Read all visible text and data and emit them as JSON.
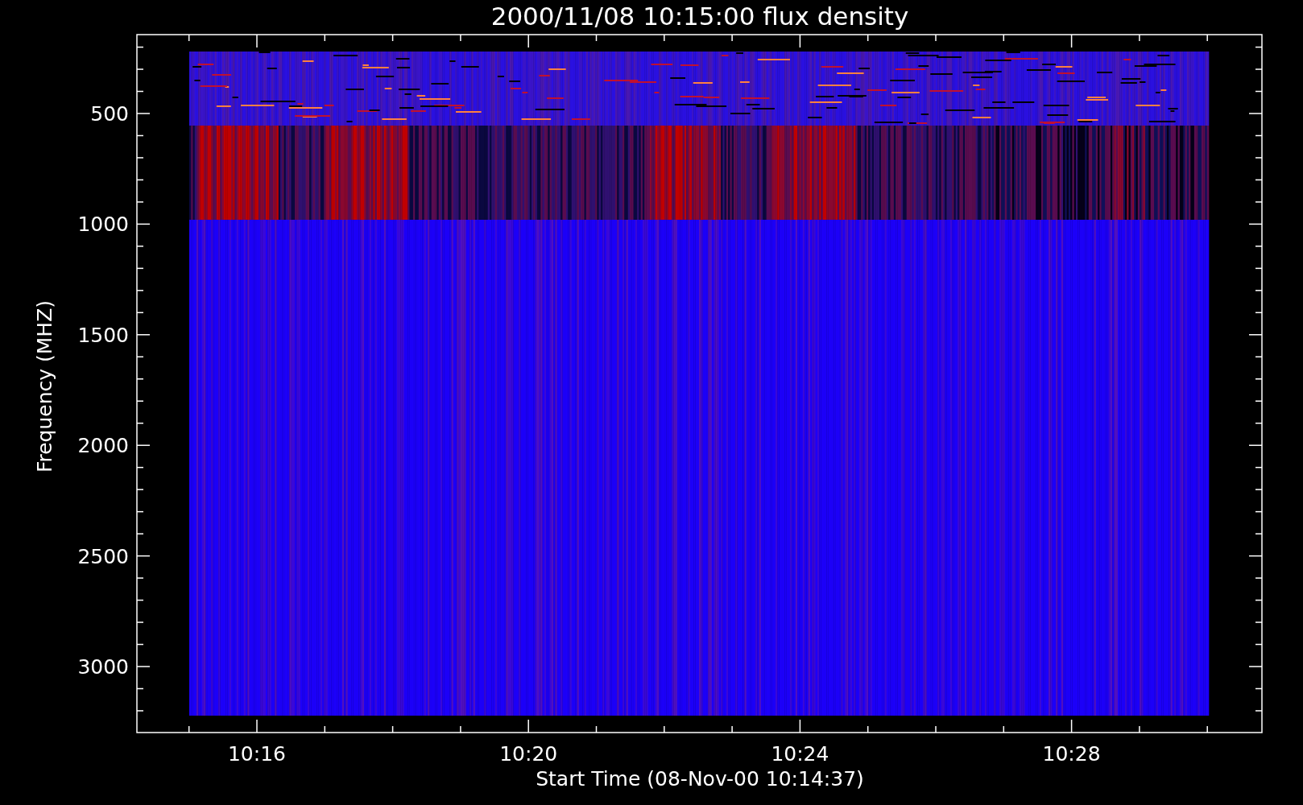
{
  "title": "2000/11/08 10:15:00 flux density",
  "y_axis": {
    "label": "Frequency (MHZ)",
    "ticks": [
      "500",
      "1000",
      "1500",
      "2000",
      "2500",
      "3000"
    ]
  },
  "x_axis": {
    "label": "Start Time (08-Nov-00 10:14:37)",
    "ticks": [
      "10:16",
      "10:20",
      "10:24",
      "10:28"
    ]
  }
}
